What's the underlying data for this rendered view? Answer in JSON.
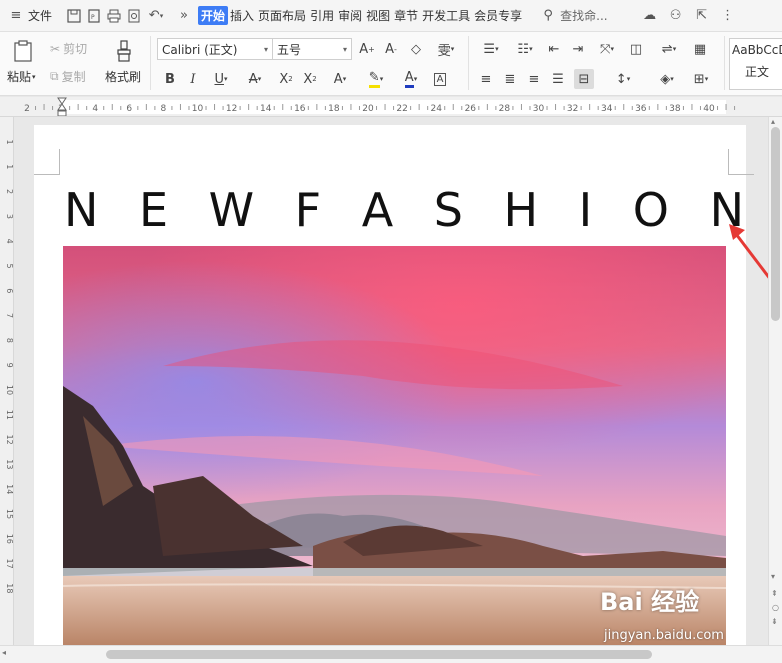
{
  "menubar": {
    "file": "文件",
    "tabs": [
      "开始",
      "插入",
      "页面布局",
      "引用",
      "审阅",
      "视图",
      "章节",
      "开发工具",
      "会员专享"
    ],
    "search_placeholder": "查找命..."
  },
  "ribbon": {
    "paste": "粘贴",
    "cut": "剪切",
    "copy": "复制",
    "format_painter": "格式刷",
    "font_name": "Calibri (正文)",
    "font_size": "五号",
    "style_preview": "AaBbCcDd",
    "style_name": "正文"
  },
  "ruler": {
    "h_ticks": [
      "2",
      "2",
      "4",
      "6",
      "8",
      "10",
      "12",
      "14",
      "16",
      "18",
      "20",
      "22",
      "24",
      "26",
      "28",
      "30",
      "32",
      "34",
      "36",
      "38",
      "40"
    ],
    "v_ticks": [
      "1",
      "1",
      "2",
      "3",
      "4",
      "5",
      "6",
      "7",
      "8",
      "9",
      "10",
      "11",
      "12",
      "13",
      "14",
      "15",
      "16",
      "17",
      "18"
    ]
  },
  "document": {
    "title_letters": [
      "N",
      "E",
      "W",
      "F",
      "A",
      "S",
      "H",
      "I",
      "O",
      "N"
    ]
  },
  "watermark": {
    "brand": "Bai 经验",
    "url": "jingyan.baidu.com"
  },
  "colors": {
    "accent": "#3d7cf5",
    "font_color_underline": "#1f3cbf",
    "highlight_underline": "#f5e000",
    "annotation_arrow": "#e53935"
  }
}
